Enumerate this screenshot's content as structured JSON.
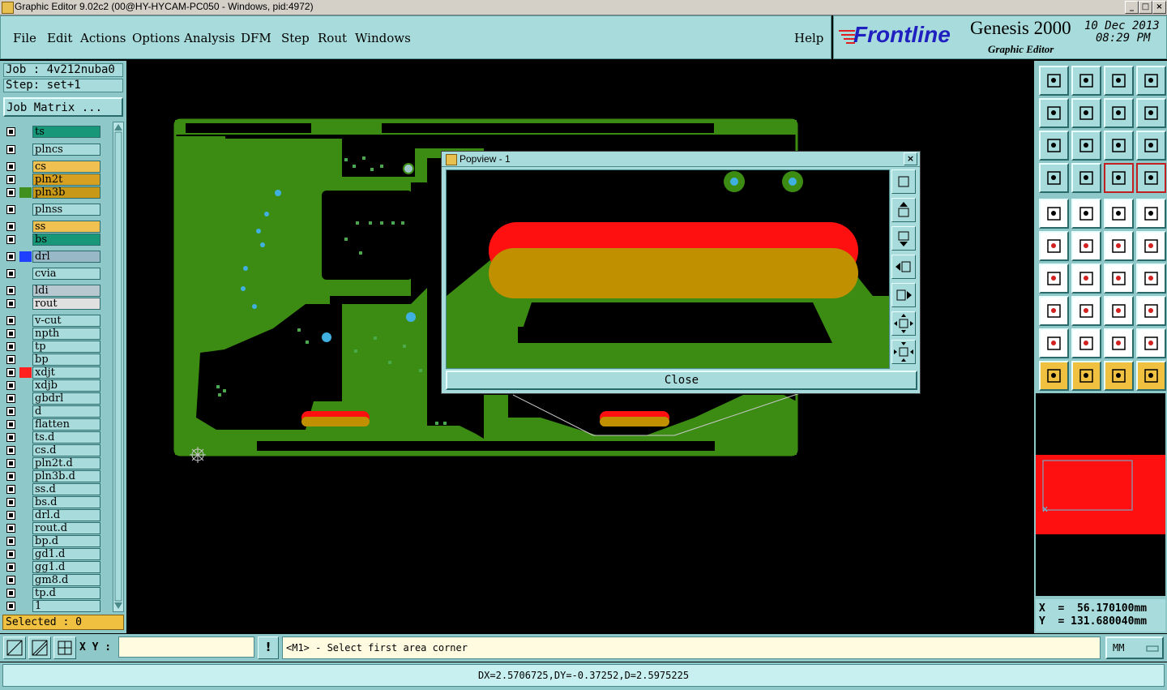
{
  "window": {
    "title": "Graphic Editor 9.02c2 (00@HY-HYCAM-PC050 - Windows, pid:4972)",
    "minimize": "_",
    "maximize": "□",
    "close": "×"
  },
  "menu": [
    "File",
    "Edit",
    "Actions",
    "Options",
    "Analysis",
    "DFM",
    "Step",
    "Rout",
    "Windows"
  ],
  "help": "Help",
  "brand": {
    "logo": "Frontline",
    "product": "Genesis 2000",
    "subtitle": "Graphic Editor",
    "date": "10 Dec 2013",
    "time": "08:29 PM"
  },
  "job": {
    "job_label": "Job : 4v212nuba0",
    "step_label": "Step: set+1",
    "matrix_button": "Job Matrix ..."
  },
  "layers": [
    {
      "name": "ts",
      "bg": "#189878",
      "swatch": ""
    },
    {
      "name": "plncs",
      "bg": "#a8dcdc",
      "swatch": ""
    },
    {
      "name": "cs",
      "bg": "#f0c050",
      "swatch": ""
    },
    {
      "name": "pln2t",
      "bg": "#d8a020",
      "swatch": ""
    },
    {
      "name": "pln3b",
      "bg": "#c89818",
      "swatch": "#409020"
    },
    {
      "name": "plnss",
      "bg": "#a8dcdc",
      "swatch": ""
    },
    {
      "name": "ss",
      "bg": "#f0c050",
      "swatch": ""
    },
    {
      "name": "bs",
      "bg": "#189878",
      "swatch": ""
    },
    {
      "name": "drl",
      "bg": "#98b8c8",
      "swatch": "#2040ff"
    },
    {
      "name": "cvia",
      "bg": "#a8dcdc",
      "swatch": ""
    },
    {
      "name": "ldi",
      "bg": "#b8c8d0",
      "swatch": ""
    },
    {
      "name": "rout",
      "bg": "#e0e0e0",
      "swatch": ""
    },
    {
      "name": "v-cut",
      "bg": "#a8dcdc",
      "swatch": ""
    },
    {
      "name": "npth",
      "bg": "#a8dcdc",
      "swatch": ""
    },
    {
      "name": "tp",
      "bg": "#a8dcdc",
      "swatch": ""
    },
    {
      "name": "bp",
      "bg": "#a8dcdc",
      "swatch": ""
    },
    {
      "name": "xdjt",
      "bg": "#a8dcdc",
      "swatch": "#ff2020"
    },
    {
      "name": "xdjb",
      "bg": "#a8dcdc",
      "swatch": ""
    },
    {
      "name": "gbdrl",
      "bg": "#a8dcdc",
      "swatch": ""
    },
    {
      "name": "d",
      "bg": "#a8dcdc",
      "swatch": ""
    },
    {
      "name": "flatten",
      "bg": "#a8dcdc",
      "swatch": ""
    },
    {
      "name": "ts.d",
      "bg": "#a8dcdc",
      "swatch": ""
    },
    {
      "name": "cs.d",
      "bg": "#a8dcdc",
      "swatch": ""
    },
    {
      "name": "pln2t.d",
      "bg": "#a8dcdc",
      "swatch": ""
    },
    {
      "name": "pln3b.d",
      "bg": "#a8dcdc",
      "swatch": ""
    },
    {
      "name": "ss.d",
      "bg": "#a8dcdc",
      "swatch": ""
    },
    {
      "name": "bs.d",
      "bg": "#a8dcdc",
      "swatch": ""
    },
    {
      "name": "drl.d",
      "bg": "#a8dcdc",
      "swatch": ""
    },
    {
      "name": "rout.d",
      "bg": "#a8dcdc",
      "swatch": ""
    },
    {
      "name": "bp.d",
      "bg": "#a8dcdc",
      "swatch": ""
    },
    {
      "name": "gd1.d",
      "bg": "#a8dcdc",
      "swatch": ""
    },
    {
      "name": "gg1.d",
      "bg": "#a8dcdc",
      "swatch": ""
    },
    {
      "name": "gm8.d",
      "bg": "#a8dcdc",
      "swatch": ""
    },
    {
      "name": "tp.d",
      "bg": "#a8dcdc",
      "swatch": ""
    },
    {
      "name": "1",
      "bg": "#a8dcdc",
      "swatch": ""
    }
  ],
  "selected": "Selected : 0",
  "popview": {
    "title": "Popview - 1",
    "close_label": "Close"
  },
  "coords": {
    "x": "X  =  56.170100mm",
    "y": "Y  = 131.680040mm"
  },
  "command": {
    "xy_label": "X Y :",
    "xy_value": "",
    "excl": "!",
    "prompt": "<M1> - Select first area corner",
    "units": "MM"
  },
  "status": "DX=2.5706725,DY=-0.37252,D=2.5975225",
  "colors": {
    "panel": "#a8dcdc",
    "board": "#3c8c14",
    "pad_red": "#ff1010",
    "pad_gold": "#c09000",
    "via": "#40b0e0"
  }
}
